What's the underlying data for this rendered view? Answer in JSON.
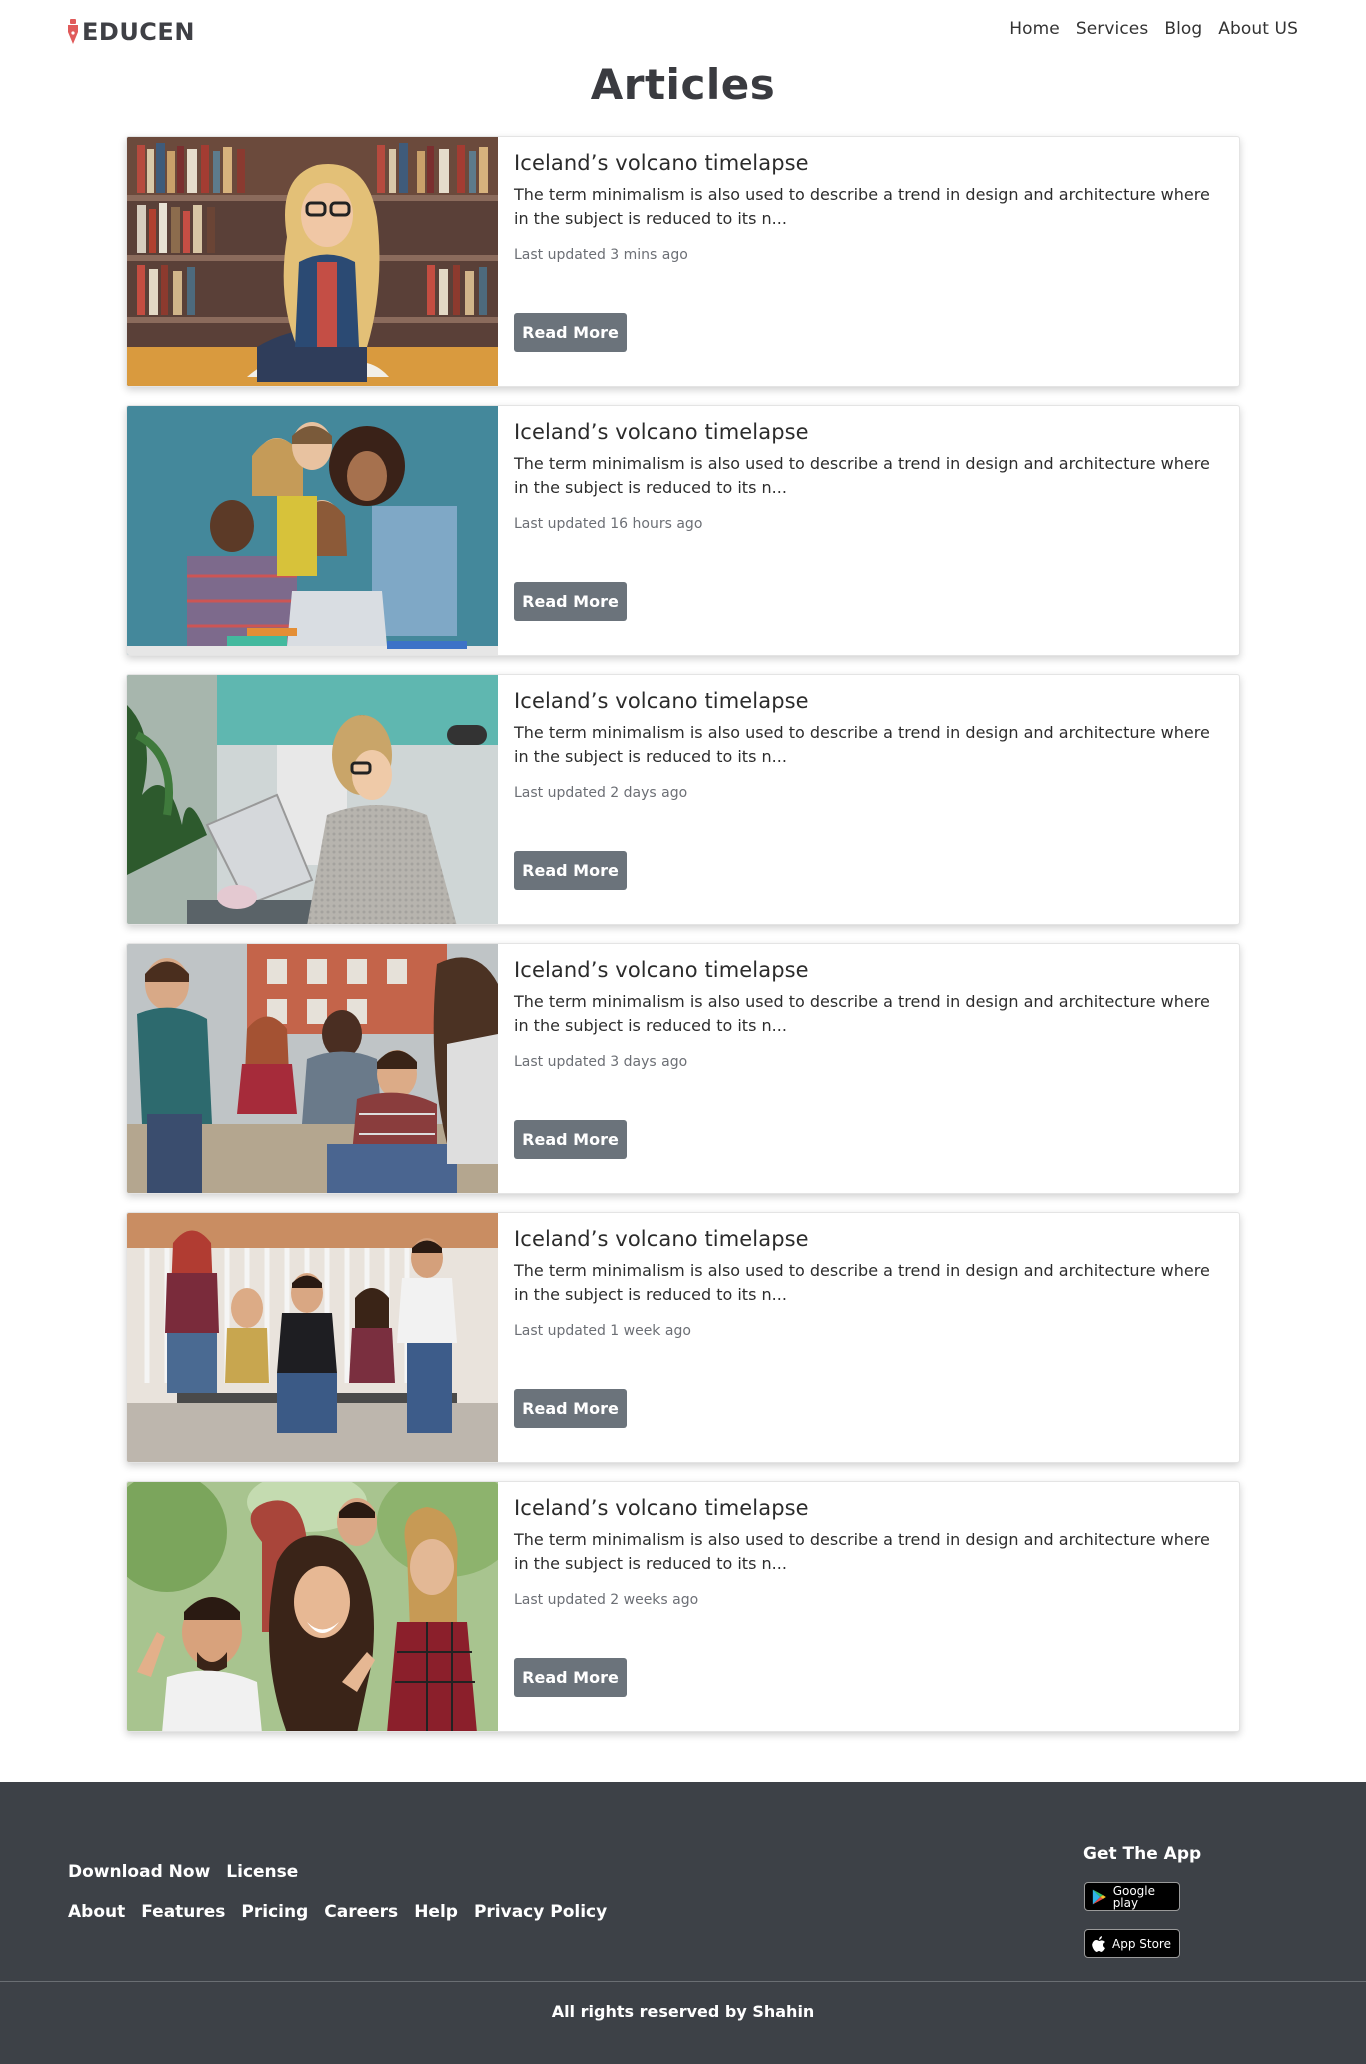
{
  "header": {
    "brand": "EDUCEN",
    "nav": [
      {
        "label": "Home"
      },
      {
        "label": "Services"
      },
      {
        "label": "Blog"
      },
      {
        "label": "About US"
      }
    ]
  },
  "main": {
    "title": "Articles",
    "articles": [
      {
        "title": "Iceland’s volcano timelapse",
        "excerpt": "The term minimalism is also used to describe a trend in design and architecture where in the subject is reduced to its n...",
        "updated": "Last updated 3 mins ago",
        "button": "Read More"
      },
      {
        "title": "Iceland’s volcano timelapse",
        "excerpt": "The term minimalism is also used to describe a trend in design and architecture where in the subject is reduced to its n...",
        "updated": "Last updated 16 hours ago",
        "button": "Read More"
      },
      {
        "title": "Iceland’s volcano timelapse",
        "excerpt": "The term minimalism is also used to describe a trend in design and architecture where in the subject is reduced to its n...",
        "updated": "Last updated 2 days ago",
        "button": "Read More"
      },
      {
        "title": "Iceland’s volcano timelapse",
        "excerpt": "The term minimalism is also used to describe a trend in design and architecture where in the subject is reduced to its n...",
        "updated": "Last updated 3 days ago",
        "button": "Read More"
      },
      {
        "title": "Iceland’s volcano timelapse",
        "excerpt": "The term minimalism is also used to describe a trend in design and architecture where in the subject is reduced to its n...",
        "updated": "Last updated 1 week ago",
        "button": "Read More"
      },
      {
        "title": "Iceland’s volcano timelapse",
        "excerpt": "The term minimalism is also used to describe a trend in design and architecture where in the subject is reduced to its n...",
        "updated": "Last updated 2 weeks ago",
        "button": "Read More"
      }
    ]
  },
  "footer": {
    "links_row1": [
      {
        "label": "Download Now"
      },
      {
        "label": "License"
      }
    ],
    "links_row2": [
      {
        "label": "About"
      },
      {
        "label": "Features"
      },
      {
        "label": "Pricing"
      },
      {
        "label": "Careers"
      },
      {
        "label": "Help"
      },
      {
        "label": "Privacy Policy"
      }
    ],
    "app_heading": "Get The App",
    "google_play": "Google play",
    "app_store": "App Store",
    "copyright": "All rights reserved by Shahin"
  },
  "colors": {
    "accent": "#e05a5a",
    "button": "#6b737b",
    "footer_bg": "#3d4147"
  }
}
